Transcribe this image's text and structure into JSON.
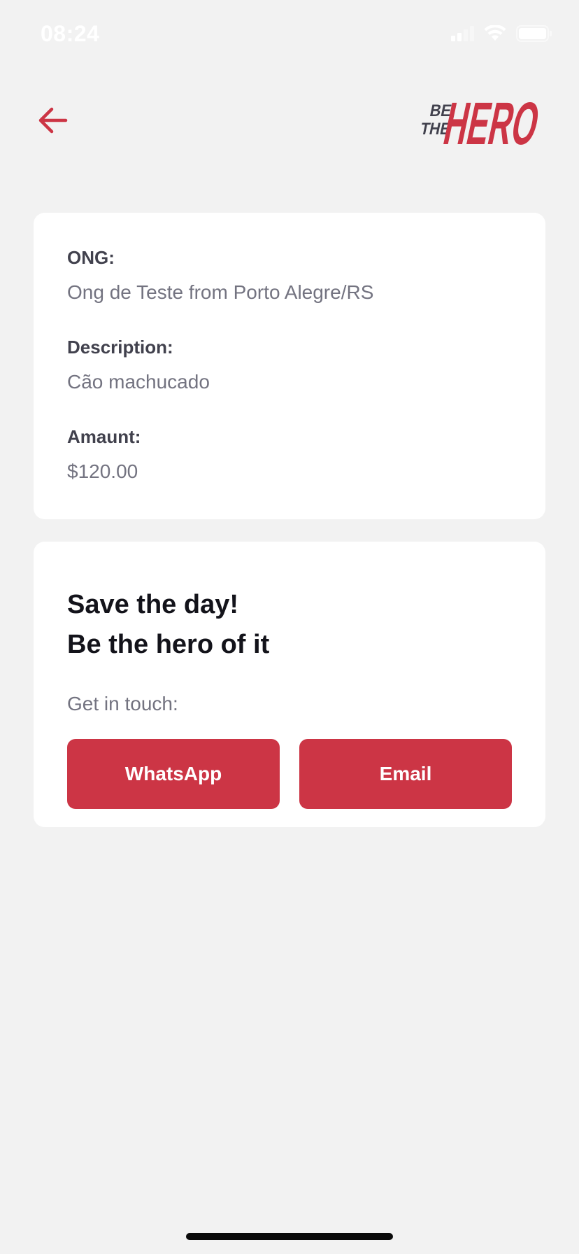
{
  "status_bar": {
    "time": "08:24"
  },
  "header": {
    "back_icon": "arrow-left-icon",
    "logo_text_small_1": "BE",
    "logo_text_small_2": "THE",
    "logo_text_big": "HERO"
  },
  "incident": {
    "ong_label": "ONG:",
    "ong_value": "Ong de Teste from Porto Alegre/RS",
    "description_label": "Description:",
    "description_value": "Cão machucado",
    "amount_label": "Amaunt:",
    "amount_value": "$120.00"
  },
  "contact": {
    "title_line_1": "Save the day!",
    "title_line_2": "Be the hero of it",
    "description": "Get in touch:",
    "whatsapp_label": "WhatsApp",
    "email_label": "Email"
  },
  "colors": {
    "accent": "#cc3545",
    "background": "#f2f2f2",
    "card": "#ffffff",
    "label": "#41414d",
    "value": "#737380",
    "title": "#13131a",
    "logo_dark": "#41414d"
  }
}
